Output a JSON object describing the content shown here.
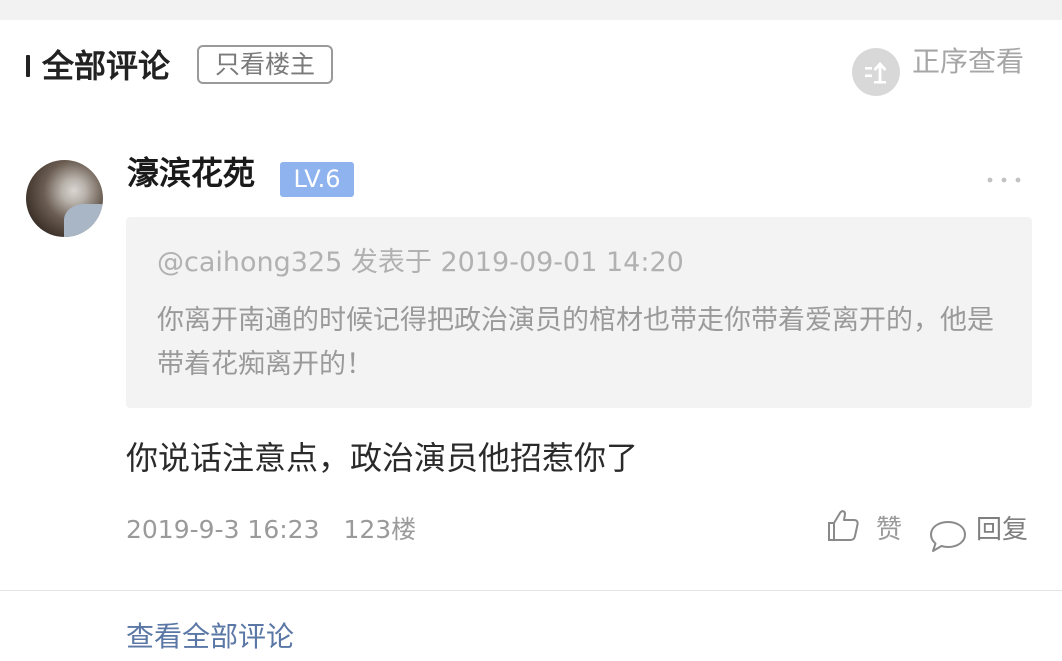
{
  "header": {
    "title": "全部评论",
    "only_op_label": "只看楼主",
    "sort_label": "正序查看",
    "sort_icon": "sort-ascending-icon"
  },
  "comment": {
    "username": "濠滨花苑",
    "level": "LV.6",
    "more_icon": "more-dots-icon",
    "quote": {
      "handle": "@caihong325",
      "posted_label": "发表于",
      "datetime": "2019-09-01 14:20",
      "text": "你离开南通的时候记得把政治演员的棺材也带走你带着爱离开的，他是带着花痴离开的！"
    },
    "reply_text": "你说话注意点，政治演员他招惹你了",
    "timestamp": "2019-9-3 16:23",
    "floor": "123楼",
    "like_label": "赞",
    "reply_label": "回复"
  },
  "footer": {
    "view_all_label": "查看全部评论"
  },
  "colors": {
    "level_badge": "#8fb3ee",
    "link": "#5a77a6",
    "quote_bg": "#f3f3f3"
  }
}
